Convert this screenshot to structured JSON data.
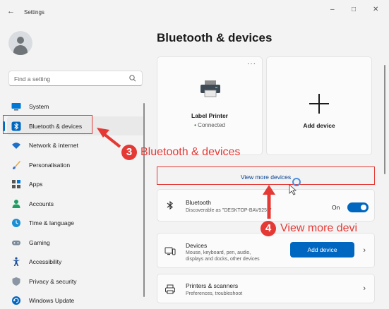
{
  "window": {
    "back_glyph": "←",
    "title": "Settings",
    "minimize_glyph": "–",
    "maximize_glyph": "□",
    "close_glyph": "✕"
  },
  "sidebar": {
    "search_placeholder": "Find a setting",
    "items": [
      {
        "label": "System",
        "icon": "monitor-icon",
        "active": false
      },
      {
        "label": "Bluetooth & devices",
        "icon": "bluetooth-icon",
        "active": true
      },
      {
        "label": "Network & internet",
        "icon": "wifi-icon",
        "active": false
      },
      {
        "label": "Personalisation",
        "icon": "brush-icon",
        "active": false
      },
      {
        "label": "Apps",
        "icon": "apps-icon",
        "active": false
      },
      {
        "label": "Accounts",
        "icon": "person-icon",
        "active": false
      },
      {
        "label": "Time & language",
        "icon": "globe-clock-icon",
        "active": false
      },
      {
        "label": "Gaming",
        "icon": "gamepad-icon",
        "active": false
      },
      {
        "label": "Accessibility",
        "icon": "accessibility-icon",
        "active": false
      },
      {
        "label": "Privacy & security",
        "icon": "shield-icon",
        "active": false
      },
      {
        "label": "Windows Update",
        "icon": "update-icon",
        "active": false
      }
    ]
  },
  "main": {
    "title": "Bluetooth & devices",
    "printer_card": {
      "more_glyph": "···",
      "name": "Label Printer",
      "status_dot": "•",
      "status": "Connected"
    },
    "add_card": {
      "label": "Add device"
    },
    "view_more": "View more devices",
    "bluetooth_row": {
      "title": "Bluetooth",
      "subtitle": "Discoverable as \"DESKTOP-BAV9259\"",
      "toggle_label": "On",
      "toggle_on": true
    },
    "devices_row": {
      "title": "Devices",
      "subtitle_line1": "Mouse, keyboard, pen, audio,",
      "subtitle_line2": "displays and docks, other devices",
      "button": "Add device",
      "chevron": "›"
    },
    "printers_row": {
      "title": "Printers & scanners",
      "subtitle": "Preferences, troubleshoot",
      "chevron": "›"
    }
  },
  "annotations": {
    "step3_number": "3",
    "step3_text": "Bluetooth & devices",
    "step4_number": "4",
    "step4_text": "View more devi"
  },
  "colors": {
    "accent": "#0067c0",
    "annotation": "#e53935",
    "connected": "#0f7b0f"
  }
}
